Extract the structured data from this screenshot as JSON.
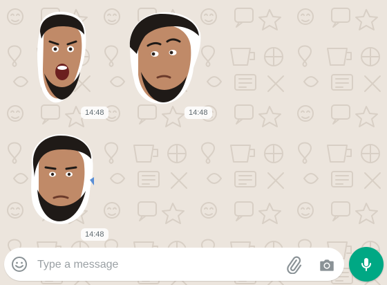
{
  "colors": {
    "wallpaper": "#ece5dd",
    "doodle": "#d8cfc5",
    "accent": "#00a884",
    "icon_gray": "#8a9296",
    "skin": "#c08a68",
    "hair": "#1f1a17"
  },
  "messages": [
    {
      "type": "sticker",
      "depicts": "face-surprised-open-mouth",
      "time": "14:48"
    },
    {
      "type": "sticker",
      "depicts": "face-raised-eyebrow-side-look",
      "time": "14:48"
    },
    {
      "type": "sticker",
      "depicts": "face-neutral-frown",
      "time": "14:48"
    }
  ],
  "composer": {
    "placeholder": "Type a message",
    "value": "",
    "emoji_icon": "emoji-icon",
    "attach_icon": "paperclip-icon",
    "camera_icon": "camera-icon",
    "mic_icon": "microphone-icon"
  }
}
